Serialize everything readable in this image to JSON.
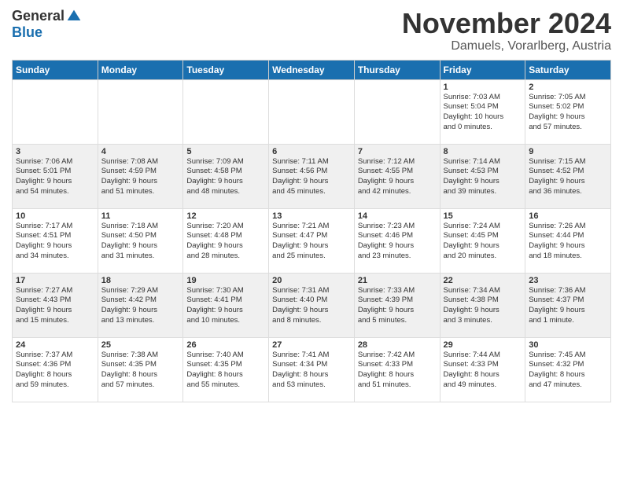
{
  "logo": {
    "general": "General",
    "blue": "Blue"
  },
  "title": "November 2024",
  "subtitle": "Damuels, Vorarlberg, Austria",
  "weekdays": [
    "Sunday",
    "Monday",
    "Tuesday",
    "Wednesday",
    "Thursday",
    "Friday",
    "Saturday"
  ],
  "weeks": [
    [
      {
        "day": "",
        "info": ""
      },
      {
        "day": "",
        "info": ""
      },
      {
        "day": "",
        "info": ""
      },
      {
        "day": "",
        "info": ""
      },
      {
        "day": "",
        "info": ""
      },
      {
        "day": "1",
        "info": "Sunrise: 7:03 AM\nSunset: 5:04 PM\nDaylight: 10 hours\nand 0 minutes."
      },
      {
        "day": "2",
        "info": "Sunrise: 7:05 AM\nSunset: 5:02 PM\nDaylight: 9 hours\nand 57 minutes."
      }
    ],
    [
      {
        "day": "3",
        "info": "Sunrise: 7:06 AM\nSunset: 5:01 PM\nDaylight: 9 hours\nand 54 minutes."
      },
      {
        "day": "4",
        "info": "Sunrise: 7:08 AM\nSunset: 4:59 PM\nDaylight: 9 hours\nand 51 minutes."
      },
      {
        "day": "5",
        "info": "Sunrise: 7:09 AM\nSunset: 4:58 PM\nDaylight: 9 hours\nand 48 minutes."
      },
      {
        "day": "6",
        "info": "Sunrise: 7:11 AM\nSunset: 4:56 PM\nDaylight: 9 hours\nand 45 minutes."
      },
      {
        "day": "7",
        "info": "Sunrise: 7:12 AM\nSunset: 4:55 PM\nDaylight: 9 hours\nand 42 minutes."
      },
      {
        "day": "8",
        "info": "Sunrise: 7:14 AM\nSunset: 4:53 PM\nDaylight: 9 hours\nand 39 minutes."
      },
      {
        "day": "9",
        "info": "Sunrise: 7:15 AM\nSunset: 4:52 PM\nDaylight: 9 hours\nand 36 minutes."
      }
    ],
    [
      {
        "day": "10",
        "info": "Sunrise: 7:17 AM\nSunset: 4:51 PM\nDaylight: 9 hours\nand 34 minutes."
      },
      {
        "day": "11",
        "info": "Sunrise: 7:18 AM\nSunset: 4:50 PM\nDaylight: 9 hours\nand 31 minutes."
      },
      {
        "day": "12",
        "info": "Sunrise: 7:20 AM\nSunset: 4:48 PM\nDaylight: 9 hours\nand 28 minutes."
      },
      {
        "day": "13",
        "info": "Sunrise: 7:21 AM\nSunset: 4:47 PM\nDaylight: 9 hours\nand 25 minutes."
      },
      {
        "day": "14",
        "info": "Sunrise: 7:23 AM\nSunset: 4:46 PM\nDaylight: 9 hours\nand 23 minutes."
      },
      {
        "day": "15",
        "info": "Sunrise: 7:24 AM\nSunset: 4:45 PM\nDaylight: 9 hours\nand 20 minutes."
      },
      {
        "day": "16",
        "info": "Sunrise: 7:26 AM\nSunset: 4:44 PM\nDaylight: 9 hours\nand 18 minutes."
      }
    ],
    [
      {
        "day": "17",
        "info": "Sunrise: 7:27 AM\nSunset: 4:43 PM\nDaylight: 9 hours\nand 15 minutes."
      },
      {
        "day": "18",
        "info": "Sunrise: 7:29 AM\nSunset: 4:42 PM\nDaylight: 9 hours\nand 13 minutes."
      },
      {
        "day": "19",
        "info": "Sunrise: 7:30 AM\nSunset: 4:41 PM\nDaylight: 9 hours\nand 10 minutes."
      },
      {
        "day": "20",
        "info": "Sunrise: 7:31 AM\nSunset: 4:40 PM\nDaylight: 9 hours\nand 8 minutes."
      },
      {
        "day": "21",
        "info": "Sunrise: 7:33 AM\nSunset: 4:39 PM\nDaylight: 9 hours\nand 5 minutes."
      },
      {
        "day": "22",
        "info": "Sunrise: 7:34 AM\nSunset: 4:38 PM\nDaylight: 9 hours\nand 3 minutes."
      },
      {
        "day": "23",
        "info": "Sunrise: 7:36 AM\nSunset: 4:37 PM\nDaylight: 9 hours\nand 1 minute."
      }
    ],
    [
      {
        "day": "24",
        "info": "Sunrise: 7:37 AM\nSunset: 4:36 PM\nDaylight: 8 hours\nand 59 minutes."
      },
      {
        "day": "25",
        "info": "Sunrise: 7:38 AM\nSunset: 4:35 PM\nDaylight: 8 hours\nand 57 minutes."
      },
      {
        "day": "26",
        "info": "Sunrise: 7:40 AM\nSunset: 4:35 PM\nDaylight: 8 hours\nand 55 minutes."
      },
      {
        "day": "27",
        "info": "Sunrise: 7:41 AM\nSunset: 4:34 PM\nDaylight: 8 hours\nand 53 minutes."
      },
      {
        "day": "28",
        "info": "Sunrise: 7:42 AM\nSunset: 4:33 PM\nDaylight: 8 hours\nand 51 minutes."
      },
      {
        "day": "29",
        "info": "Sunrise: 7:44 AM\nSunset: 4:33 PM\nDaylight: 8 hours\nand 49 minutes."
      },
      {
        "day": "30",
        "info": "Sunrise: 7:45 AM\nSunset: 4:32 PM\nDaylight: 8 hours\nand 47 minutes."
      }
    ]
  ]
}
